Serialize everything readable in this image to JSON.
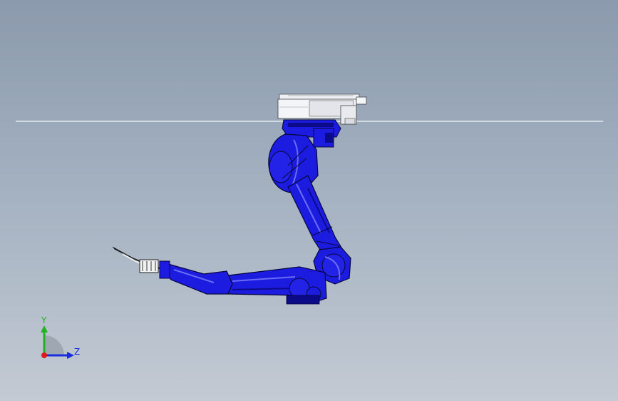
{
  "viewport": {
    "background_top": "#8b9aac",
    "background_bottom": "#c3cad3"
  },
  "model": {
    "robot_color": "#1c1ce0",
    "robot_dark": "#0b0b8a",
    "robot_light": "#5a5cf0",
    "base_color": "#e8e8ee",
    "ground_line_color": "#f2f4f7"
  },
  "triad": {
    "y_label": "Y",
    "z_label": "Z",
    "y_color": "#1fb31f",
    "z_color": "#1a2be0",
    "x_color": "#e01a1a"
  }
}
